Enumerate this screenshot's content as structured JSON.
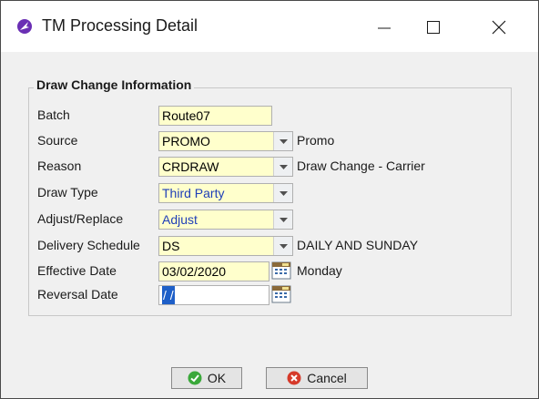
{
  "window": {
    "title": "TM Processing Detail"
  },
  "group": {
    "title": "Draw Change Information"
  },
  "fields": {
    "batch": {
      "label": "Batch",
      "value": "Route07"
    },
    "source": {
      "label": "Source",
      "value": "PROMO",
      "desc": "Promo"
    },
    "reason": {
      "label": "Reason",
      "value": "CRDRAW",
      "desc": "Draw Change - Carrier"
    },
    "draw_type": {
      "label": "Draw Type",
      "value": "Third Party"
    },
    "adjust_replace": {
      "label": "Adjust/Replace",
      "value": "Adjust"
    },
    "delivery_schedule": {
      "label": "Delivery Schedule",
      "value": "DS",
      "desc": "DAILY AND SUNDAY"
    },
    "effective_date": {
      "label": "Effective Date",
      "value": "03/02/2020",
      "desc": "Monday"
    },
    "reversal_date": {
      "label": "Reversal Date",
      "value": "/ /"
    }
  },
  "buttons": {
    "ok": "OK",
    "cancel": "Cancel"
  },
  "colors": {
    "field_bg": "#ffffcc",
    "accent_text": "#1f3fb8",
    "selection": "#1e5fc8"
  },
  "icons": [
    "app-icon",
    "minimize-icon",
    "maximize-icon",
    "close-icon",
    "dropdown-arrow-icon",
    "calendar-icon",
    "ok-check-icon",
    "cancel-x-icon"
  ]
}
